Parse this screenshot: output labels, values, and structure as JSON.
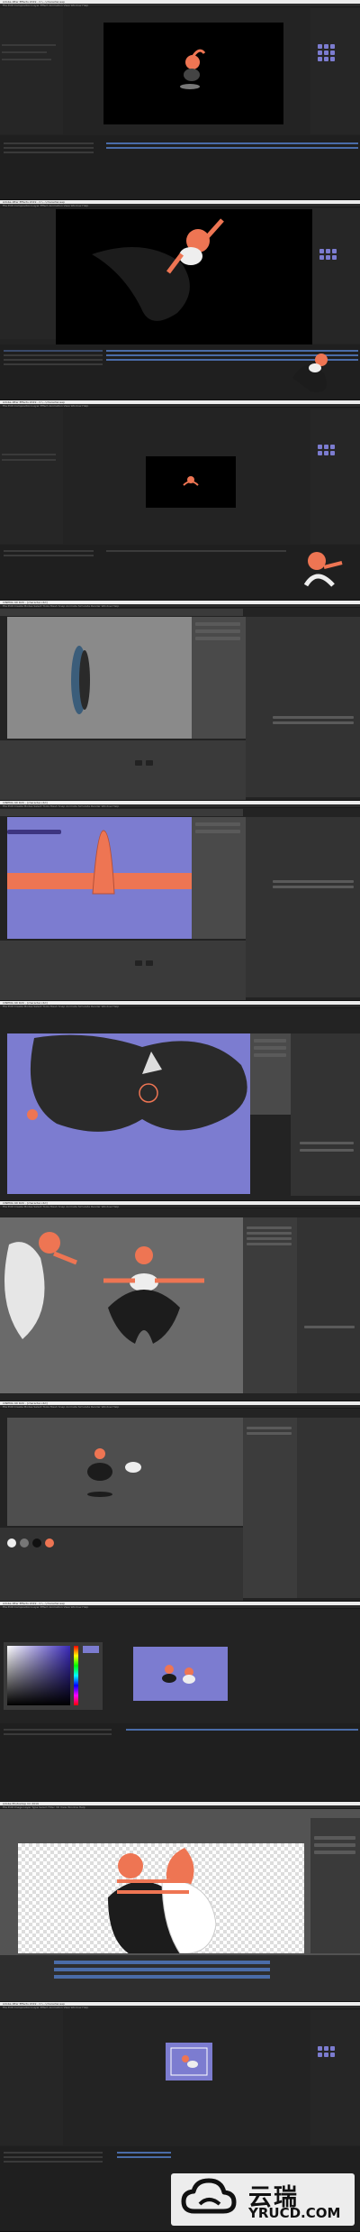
{
  "screens": [
    {
      "app": "Adobe After Effects",
      "title": "Adobe After Effects 2019 - C:\\...\\character.aep",
      "menu": "File  Edit  Composition  Layer  Effect  Animation  View  Window  Help"
    },
    {
      "app": "Adobe After Effects",
      "title": "Adobe After Effects 2019 - C:\\...\\character.aep",
      "menu": "File  Edit  Composition  Layer  Effect  Animation  View  Window  Help"
    },
    {
      "app": "Adobe After Effects",
      "title": "Adobe After Effects 2019 - C:\\...\\character.aep",
      "menu": "File  Edit  Composition  Layer  Effect  Animation  View  Window  Help"
    },
    {
      "app": "Cinema 4D",
      "title": "CINEMA 4D R20 - [character.c4d]",
      "menu": "File  Edit  Create  Modes  Select  Tools  Mesh  Snap  Animate  Simulate  Render  Window  Help"
    },
    {
      "app": "Cinema 4D",
      "title": "CINEMA 4D R20 - [character.c4d]",
      "menu": "File  Edit  Create  Modes  Select  Tools  Mesh  Snap  Animate  Simulate  Render  Window  Help"
    },
    {
      "app": "Cinema 4D",
      "title": "CINEMA 4D R20 - [character.c4d]",
      "menu": "File  Edit  Create  Modes  Select  Tools  Mesh  Snap  Animate  Simulate  Render  Window  Help"
    },
    {
      "app": "Cinema 4D",
      "title": "CINEMA 4D R20 - [character.c4d]",
      "menu": "File  Edit  Create  Modes  Select  Tools  Mesh  Snap  Animate  Simulate  Render  Window  Help"
    },
    {
      "app": "Cinema 4D",
      "title": "CINEMA 4D R20 - [character.c4d]",
      "menu": "File  Edit  Create  Modes  Select  Tools  Mesh  Snap  Animate  Simulate  Render  Window  Help"
    },
    {
      "app": "Adobe After Effects",
      "title": "Adobe After Effects 2019 - C:\\...\\character.aep",
      "menu": "File  Edit  Composition  Layer  Effect  Animation  View  Window  Help"
    },
    {
      "app": "Adobe Photoshop",
      "title": "Adobe Photoshop CC 2019",
      "menu": "File  Edit  Image  Layer  Type  Select  Filter  3D  View  Window  Help"
    },
    {
      "app": "Adobe After Effects",
      "title": "Adobe After Effects 2019 - C:\\...\\character.aep",
      "menu": "File  Edit  Composition  Layer  Effect  Animation  View  Window  Help"
    }
  ],
  "watermark": {
    "cn": "云瑞",
    "en": "YRUCD.COM"
  },
  "colors": {
    "accent": "#ee7553",
    "viewport_purple": "#7c7cd0",
    "track_blue": "#4a6ca8"
  }
}
